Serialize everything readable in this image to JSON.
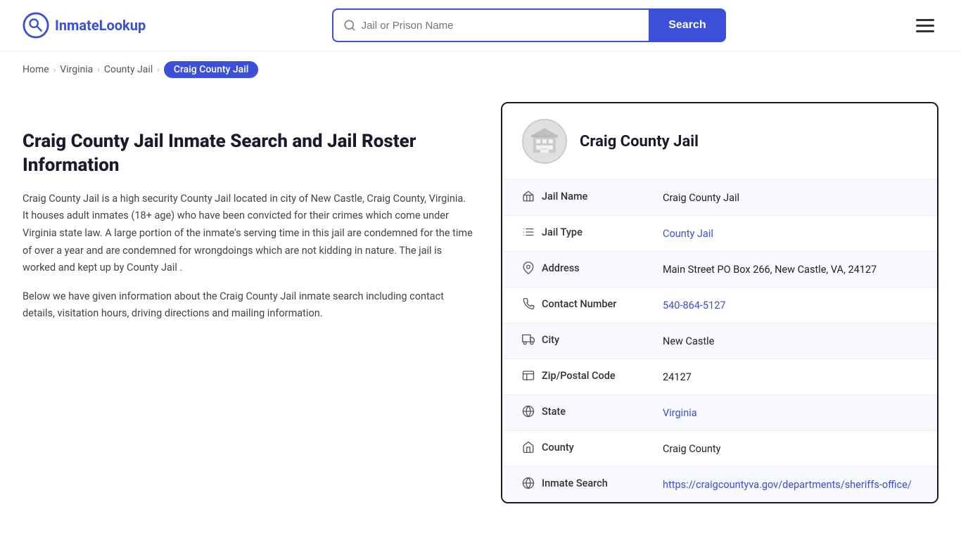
{
  "site": {
    "logo_text_main": "Inmate",
    "logo_text_accent": "Lookup"
  },
  "header": {
    "search_placeholder": "Jail or Prison Name",
    "search_button_label": "Search"
  },
  "breadcrumb": {
    "items": [
      {
        "label": "Home",
        "href": "#"
      },
      {
        "label": "Virginia",
        "href": "#"
      },
      {
        "label": "County Jail",
        "href": "#"
      }
    ],
    "active": "Craig County Jail"
  },
  "left": {
    "heading": "Craig County Jail Inmate Search and Jail Roster Information",
    "paragraph1": "Craig County Jail is a high security County Jail located in city of New Castle, Craig County, Virginia. It houses adult inmates (18+ age) who have been convicted for their crimes which come under Virginia state law. A large portion of the inmate's serving time in this jail are condemned for the time of over a year and are condemned for wrongdoings which are not kidding in nature. The jail is worked and kept up by County Jail .",
    "paragraph2": "Below we have given information about the Craig County Jail inmate search including contact details, visitation hours, driving directions and mailing information."
  },
  "card": {
    "facility_name": "Craig County Jail",
    "rows": [
      {
        "icon": "jail-icon",
        "label": "Jail Name",
        "value": "Craig County Jail",
        "link": false
      },
      {
        "icon": "type-icon",
        "label": "Jail Type",
        "value": "County Jail",
        "link": true,
        "href": "#"
      },
      {
        "icon": "address-icon",
        "label": "Address",
        "value": "Main Street PO Box 266, New Castle, VA, 24127",
        "link": false
      },
      {
        "icon": "phone-icon",
        "label": "Contact Number",
        "value": "540-864-5127",
        "link": true,
        "href": "tel:540-864-5127"
      },
      {
        "icon": "city-icon",
        "label": "City",
        "value": "New Castle",
        "link": false
      },
      {
        "icon": "zip-icon",
        "label": "Zip/Postal Code",
        "value": "24127",
        "link": false
      },
      {
        "icon": "state-icon",
        "label": "State",
        "value": "Virginia",
        "link": true,
        "href": "#"
      },
      {
        "icon": "county-icon",
        "label": "County",
        "value": "Craig County",
        "link": false
      },
      {
        "icon": "inmate-icon",
        "label": "Inmate Search",
        "value": "https://craigcountyva.gov/departments/sheriffs-office/",
        "link": true,
        "href": "https://craigcountyva.gov/departments/sheriffs-office/"
      }
    ]
  }
}
